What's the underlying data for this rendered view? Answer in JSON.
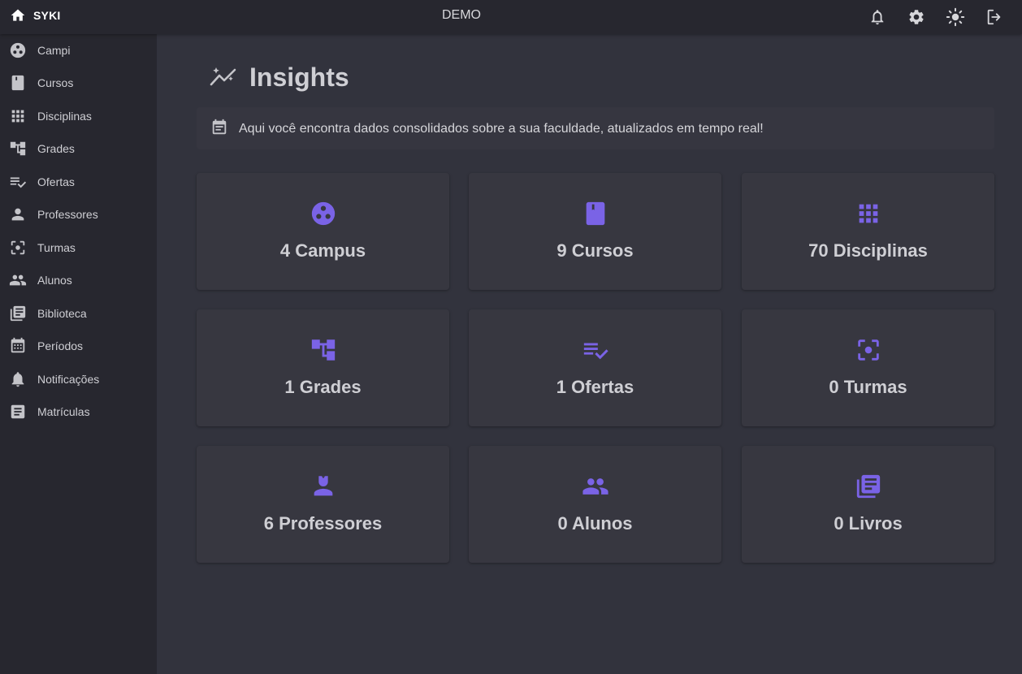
{
  "app": {
    "name": "SYKI",
    "environment": "DEMO"
  },
  "topbar": {
    "icons": [
      "bell-icon",
      "gear-icon",
      "sun-icon",
      "logout-icon"
    ]
  },
  "sidebar": {
    "items": [
      {
        "label": "Campi",
        "icon": "campus-icon"
      },
      {
        "label": "Cursos",
        "icon": "book-icon"
      },
      {
        "label": "Disciplinas",
        "icon": "grid-icon"
      },
      {
        "label": "Grades",
        "icon": "tree-icon"
      },
      {
        "label": "Ofertas",
        "icon": "playlist-check-icon"
      },
      {
        "label": "Professores",
        "icon": "person-icon"
      },
      {
        "label": "Turmas",
        "icon": "focus-icon"
      },
      {
        "label": "Alunos",
        "icon": "people-icon"
      },
      {
        "label": "Biblioteca",
        "icon": "library-icon"
      },
      {
        "label": "Períodos",
        "icon": "calendar-icon"
      },
      {
        "label": "Notificações",
        "icon": "bell-icon"
      },
      {
        "label": "Matrículas",
        "icon": "article-icon"
      }
    ]
  },
  "main": {
    "title": "Insights",
    "info": "Aqui você encontra dados consolidados sobre a sua faculdade, atualizados em tempo real!",
    "cards": [
      {
        "text": "4 Campus",
        "icon": "campus-icon"
      },
      {
        "text": "9 Cursos",
        "icon": "book-icon"
      },
      {
        "text": "70 Disciplinas",
        "icon": "grid-icon"
      },
      {
        "text": "1 Grades",
        "icon": "tree-icon"
      },
      {
        "text": "1 Ofertas",
        "icon": "playlist-check-icon"
      },
      {
        "text": "0 Turmas",
        "icon": "focus-icon"
      },
      {
        "text": "6 Professores",
        "icon": "teacher-icon"
      },
      {
        "text": "0 Alunos",
        "icon": "people-icon"
      },
      {
        "text": "0 Livros",
        "icon": "library-icon"
      }
    ]
  },
  "colors": {
    "accent": "#7a63e6",
    "icon_gray": "#c4c4c9",
    "sidebar_bg": "#27272f",
    "content_bg": "#32333d"
  }
}
